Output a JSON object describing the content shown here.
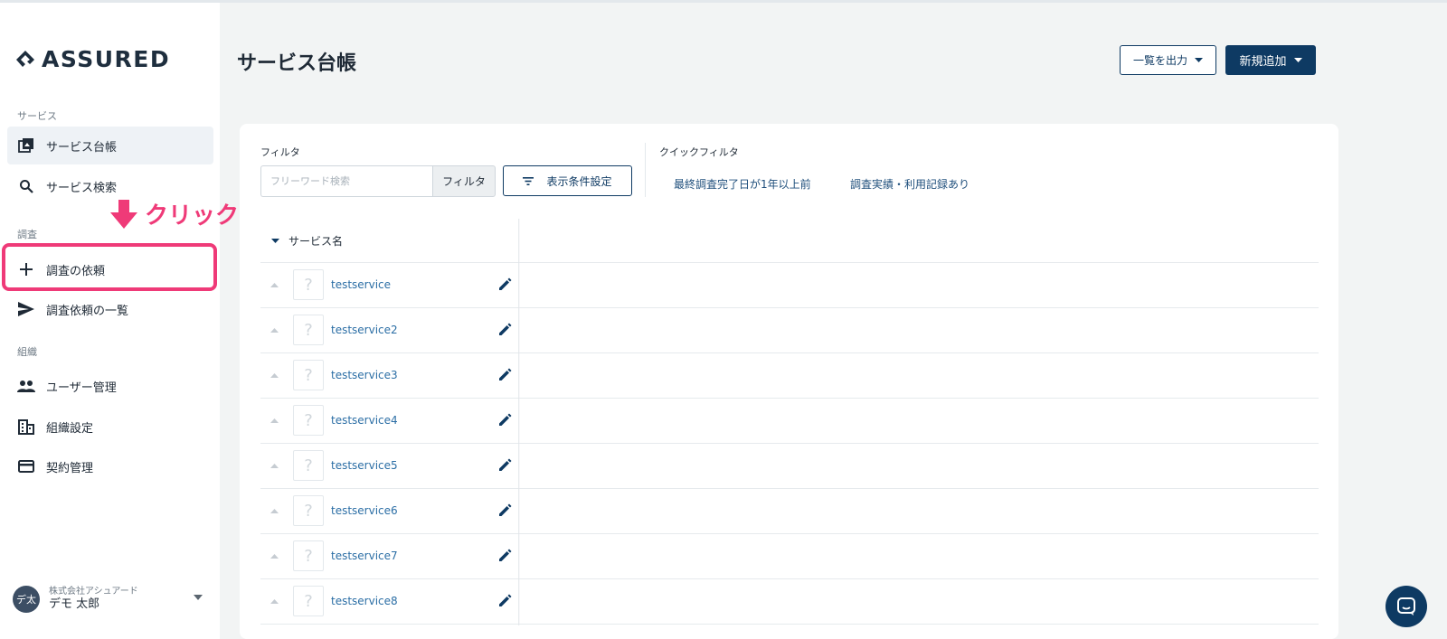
{
  "app": {
    "logo_text": "ASSURED"
  },
  "sidebar": {
    "sections": [
      {
        "label": "サービス"
      },
      {
        "label": "調査"
      },
      {
        "label": "組織"
      }
    ],
    "items": [
      {
        "label": "サービス台帳",
        "icon": "library-icon",
        "active": true
      },
      {
        "label": "サービス検索",
        "icon": "search-icon"
      },
      {
        "label": "調査の依頼",
        "icon": "plus-icon"
      },
      {
        "label": "調査依頼の一覧",
        "icon": "send-icon"
      },
      {
        "label": "ユーザー管理",
        "icon": "people-icon"
      },
      {
        "label": "組織設定",
        "icon": "building-icon"
      },
      {
        "label": "契約管理",
        "icon": "credit-card-icon"
      }
    ],
    "user": {
      "avatar": "デ太",
      "company": "株式会社アシュアード",
      "name": "デモ 太郎"
    }
  },
  "annotation": {
    "text": "クリック",
    "color": "#ef3a78"
  },
  "header": {
    "title": "サービス台帳",
    "export_label": "一覧を出力",
    "new_label": "新規追加"
  },
  "filter": {
    "label": "フィルタ",
    "search_placeholder": "フリーワード検索",
    "search_button": "フィルタ",
    "display_settings": "表示条件設定"
  },
  "quick_filter": {
    "label": "クイックフィルタ",
    "links": [
      "最終調査完了日が1年以上前",
      "調査実績・利用記録あり"
    ]
  },
  "table": {
    "column": "サービス名",
    "rows": [
      {
        "name": "testservice",
        "thumb": "?"
      },
      {
        "name": "testservice2",
        "thumb": "?"
      },
      {
        "name": "testservice3",
        "thumb": "?"
      },
      {
        "name": "testservice4",
        "thumb": "?"
      },
      {
        "name": "testservice5",
        "thumb": "?"
      },
      {
        "name": "testservice6",
        "thumb": "?"
      },
      {
        "name": "testservice7",
        "thumb": "?"
      },
      {
        "name": "testservice8",
        "thumb": "?"
      }
    ]
  },
  "colors": {
    "primary": "#0e3a63",
    "link": "#2b6ea5",
    "highlight": "#ef3a78",
    "background": "#f2f4f4"
  }
}
